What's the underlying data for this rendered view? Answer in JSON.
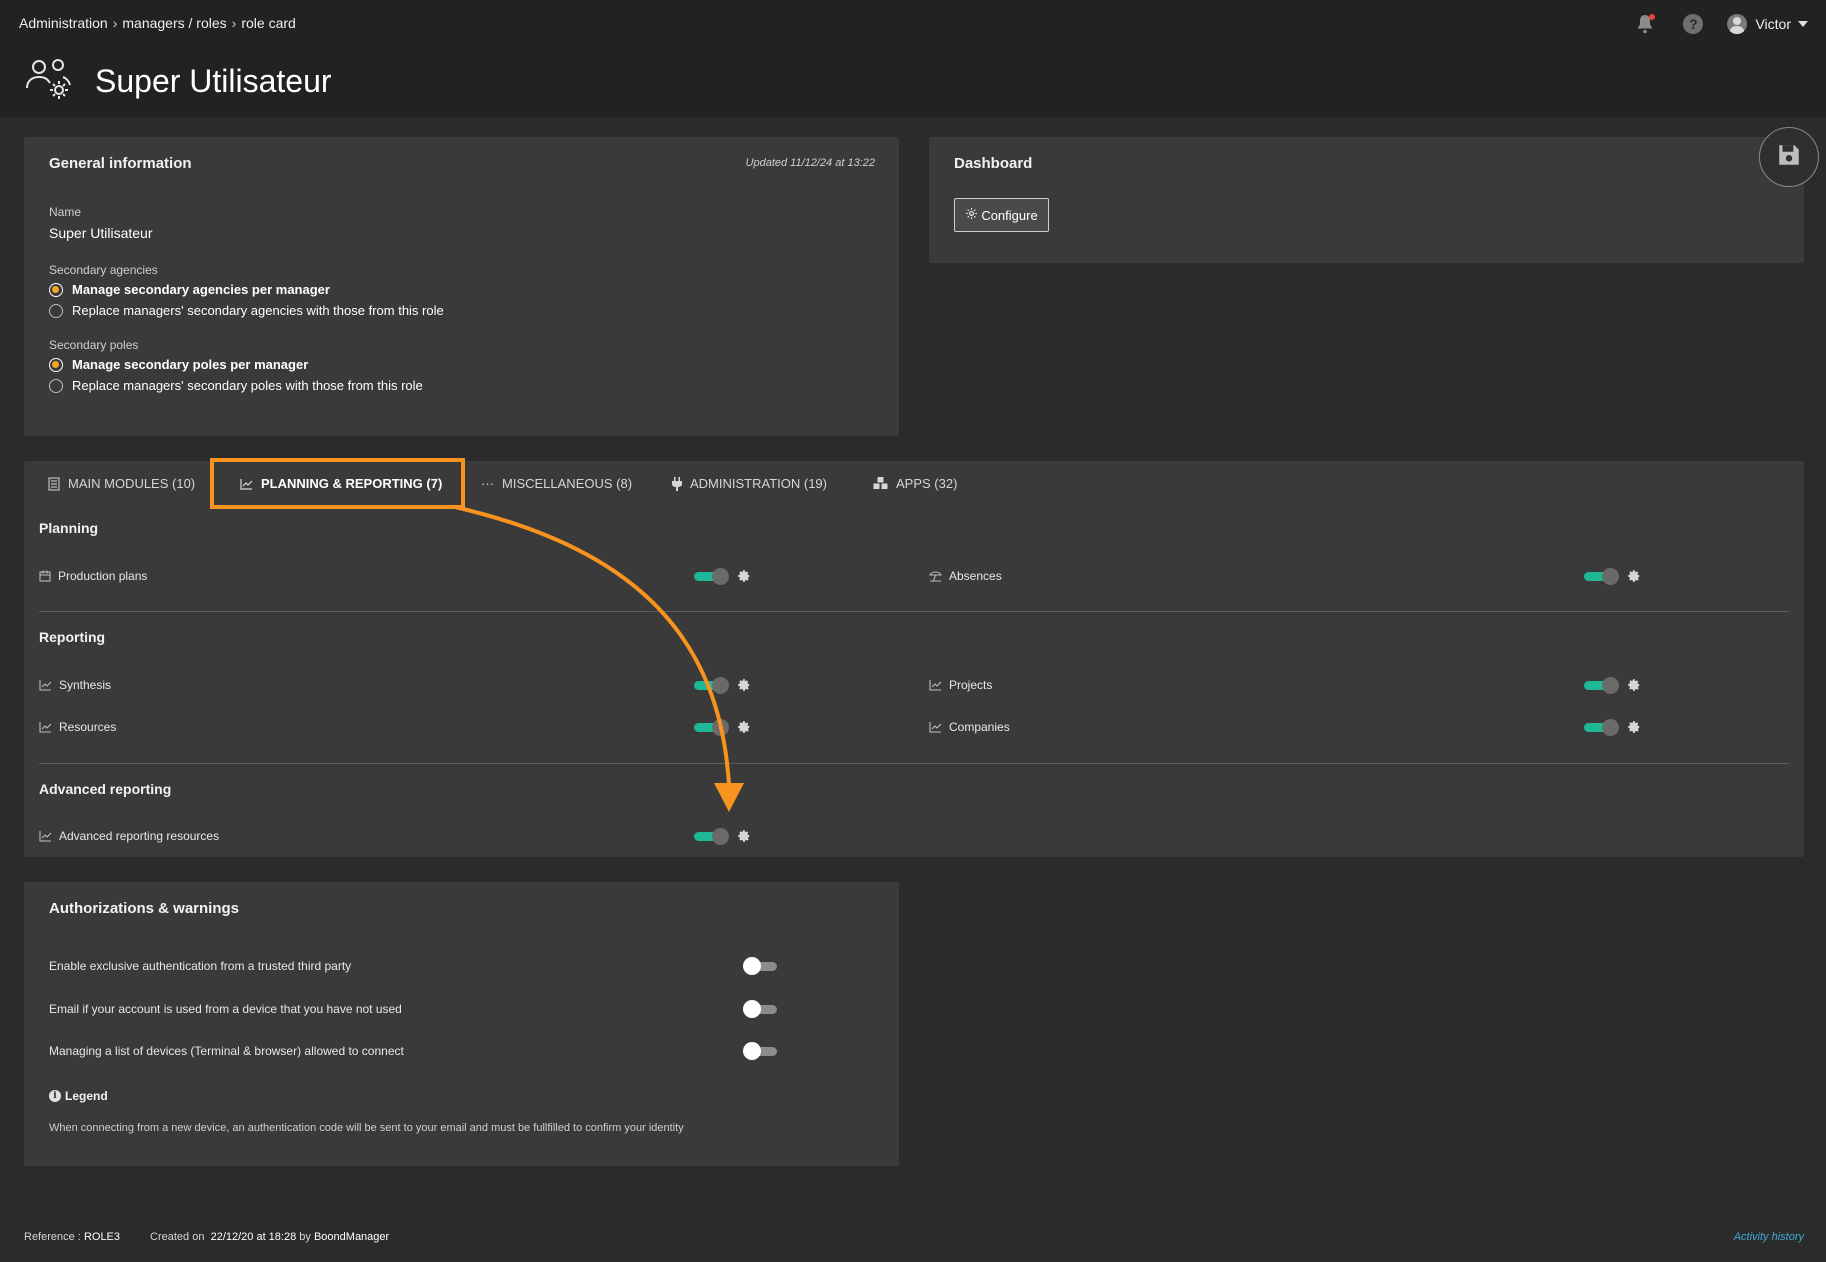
{
  "breadcrumb": [
    "Administration",
    "managers / roles",
    "role card"
  ],
  "header": {
    "title": "Super Utilisateur",
    "user": "Victor"
  },
  "general": {
    "title": "General information",
    "updated": "Updated 11/12/24 at 13:22",
    "name_label": "Name",
    "name_value": "Super Utilisateur",
    "agencies_label": "Secondary agencies",
    "agencies_options": [
      "Manage secondary agencies per manager",
      "Replace managers' secondary agencies with those from this role"
    ],
    "agencies_selected": 0,
    "poles_label": "Secondary poles",
    "poles_options": [
      "Manage secondary poles per manager",
      "Replace managers' secondary poles with those from this role"
    ],
    "poles_selected": 0
  },
  "dashboard": {
    "title": "Dashboard",
    "configure": "Configure"
  },
  "tabs": [
    {
      "label": "MAIN MODULES (10)",
      "icon": "file-icon"
    },
    {
      "label": "PLANNING & REPORTING (7)",
      "icon": "chart-icon",
      "active": true
    },
    {
      "label": "MISCELLANEOUS (8)",
      "icon": "dots-icon"
    },
    {
      "label": "ADMINISTRATION (19)",
      "icon": "plug-icon"
    },
    {
      "label": "APPS (32)",
      "icon": "cubes-icon"
    }
  ],
  "sections": {
    "planning": {
      "title": "Planning",
      "items": [
        {
          "label": "Production plans",
          "icon": "calendar-icon",
          "enabled": true
        },
        {
          "label": "Absences",
          "icon": "beach-umbrella-icon",
          "enabled": true
        }
      ]
    },
    "reporting": {
      "title": "Reporting",
      "items": [
        {
          "label": "Synthesis",
          "icon": "chart-icon",
          "enabled": true
        },
        {
          "label": "Projects",
          "icon": "chart-icon",
          "enabled": true
        },
        {
          "label": "Resources",
          "icon": "chart-icon",
          "enabled": true
        },
        {
          "label": "Companies",
          "icon": "chart-icon",
          "enabled": true
        }
      ]
    },
    "advanced": {
      "title": "Advanced reporting",
      "items": [
        {
          "label": "Advanced reporting resources",
          "icon": "chart-icon",
          "enabled": true
        }
      ]
    }
  },
  "auth": {
    "title": "Authorizations & warnings",
    "items": [
      {
        "label": "Enable exclusive authentication from a trusted third party",
        "enabled": false
      },
      {
        "label": "Email if your account is used from a device that you have not used",
        "enabled": false
      },
      {
        "label": "Managing a list of devices (Terminal & browser) allowed to connect",
        "enabled": false
      }
    ],
    "legend_title": "Legend",
    "legend_text": "When connecting from a new device, an authentication code will be sent to your email and must be fullfilled to confirm your identity"
  },
  "footer": {
    "reference_label": "Reference :",
    "reference_value": "ROLE3",
    "created_label": "Created on",
    "created_date": "22/12/20 at 18:28",
    "by_label": "by",
    "created_by": "BoondManager",
    "activity_link": "Activity history"
  },
  "colors": {
    "accent": "#f7931e",
    "toggle_on": "#1fb896",
    "radio_selected": "#f5a623",
    "link": "#3fa9d9"
  }
}
